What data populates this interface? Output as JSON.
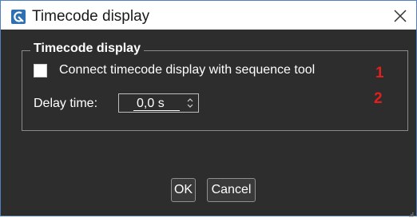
{
  "window": {
    "title": "Timecode display",
    "app_icon": "app-logo-icon",
    "close_icon": "close-icon"
  },
  "group": {
    "title": "Timecode display",
    "checkbox_label": "Connect timecode display with sequence tool",
    "checkbox_checked": false,
    "delay_label": "Delay time:",
    "delay_value": "0,0 s"
  },
  "markers": {
    "first": "1",
    "second": "2"
  },
  "buttons": {
    "ok": "OK",
    "cancel": "Cancel"
  },
  "colors": {
    "client_bg": "#2d2d2d",
    "marker": "#e0201c",
    "icon_blue": "#2f70b3"
  }
}
